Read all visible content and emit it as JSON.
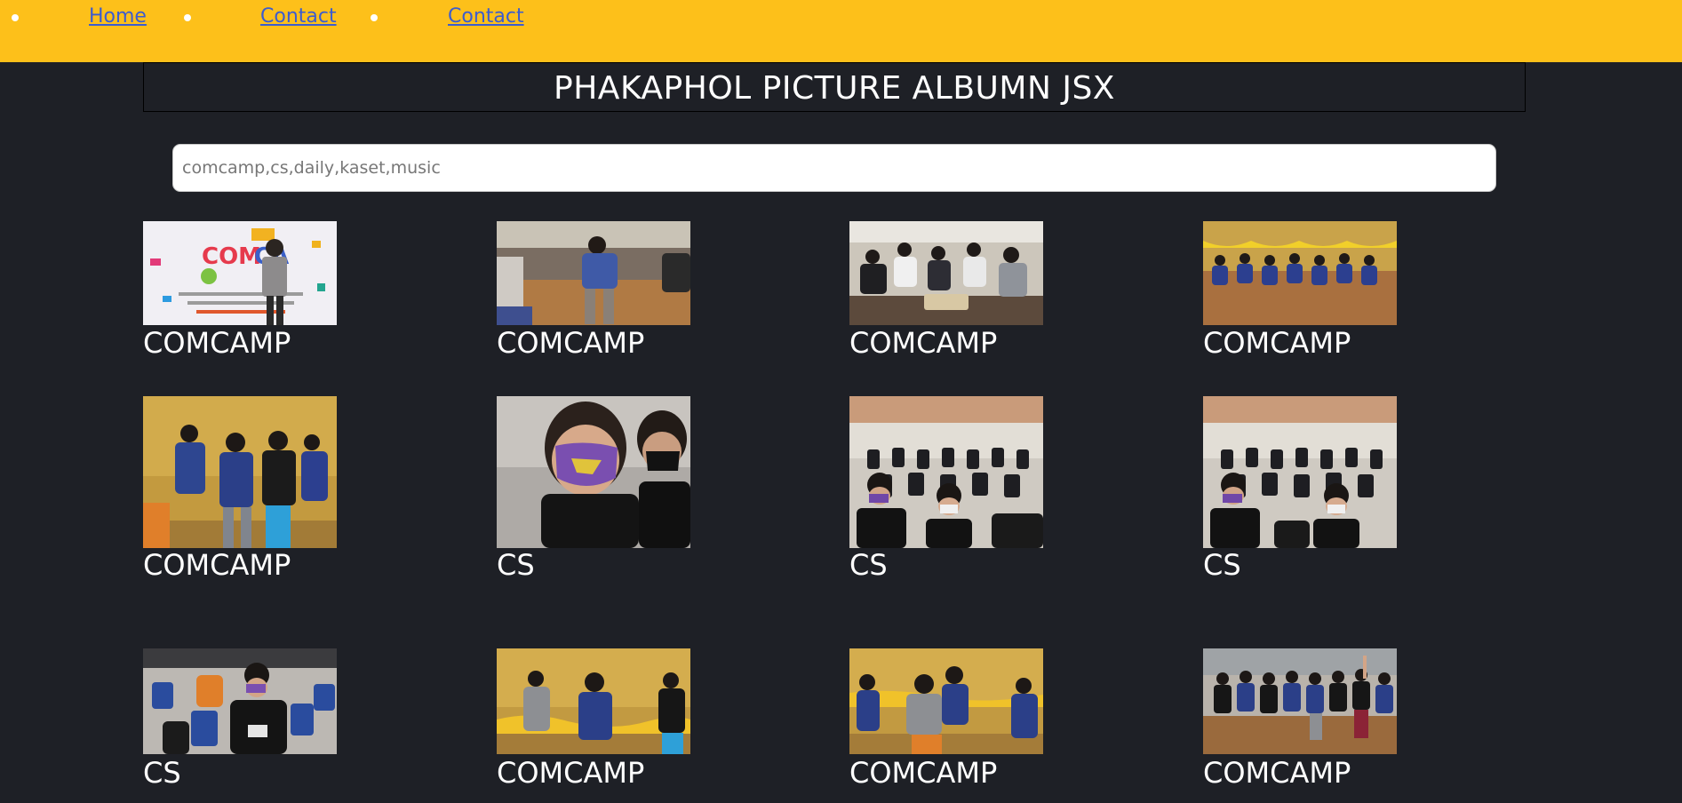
{
  "nav": {
    "items": [
      {
        "label": "Home"
      },
      {
        "label": "Contact"
      },
      {
        "label": "Contact"
      }
    ]
  },
  "page": {
    "title": "PHAKAPHOL PICTURE ALBUMN JSX"
  },
  "search": {
    "placeholder": "comcamp,cs,daily,kaset,music",
    "value": ""
  },
  "colors": {
    "nav_bg": "#fdc01a",
    "page_bg": "#1e2026",
    "link": "#3c5ccf",
    "label": "#ffffff"
  },
  "gallery": {
    "items": [
      {
        "label": "COMCAMP",
        "photo": "person-standing-at-comcamp-sign"
      },
      {
        "label": "COMCAMP",
        "photo": "student-dancing-in-hall"
      },
      {
        "label": "COMCAMP",
        "photo": "group-seated-around-table"
      },
      {
        "label": "COMCAMP",
        "photo": "group-seated-on-stage-floor"
      },
      {
        "label": "COMCAMP",
        "photo": "students-dancing-in-blue-shirts"
      },
      {
        "label": "CS",
        "photo": "student-with-purple-mask"
      },
      {
        "label": "CS",
        "photo": "students-seated-in-auditorium"
      },
      {
        "label": "CS",
        "photo": "students-seated-in-auditorium"
      },
      {
        "label": "CS",
        "photo": "student-seated-in-chairs"
      },
      {
        "label": "COMCAMP",
        "photo": "students-playing-game"
      },
      {
        "label": "COMCAMP",
        "photo": "students-dancing-on-stage"
      },
      {
        "label": "COMCAMP",
        "photo": "group-dancing-in-hall"
      }
    ]
  }
}
